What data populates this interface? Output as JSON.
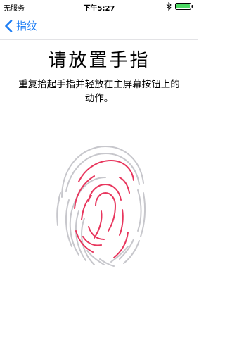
{
  "status_bar": {
    "carrier": "无服务",
    "time": "下午5:27",
    "bluetooth_icon": "bluetooth-icon",
    "battery_icon": "battery-icon",
    "battery_color": "#4cd964"
  },
  "nav_bar": {
    "back_label": "指纹",
    "back_icon": "chevron-left-icon",
    "accent_color": "#1a7cf4"
  },
  "main": {
    "title": "请放置手指",
    "instruction": "重复抬起手指并轻放在主屏幕按钮上的动作。",
    "fingerprint_icon": "fingerprint-icon",
    "progress_color": "#e8365d",
    "idle_color": "#c7c7cc"
  }
}
